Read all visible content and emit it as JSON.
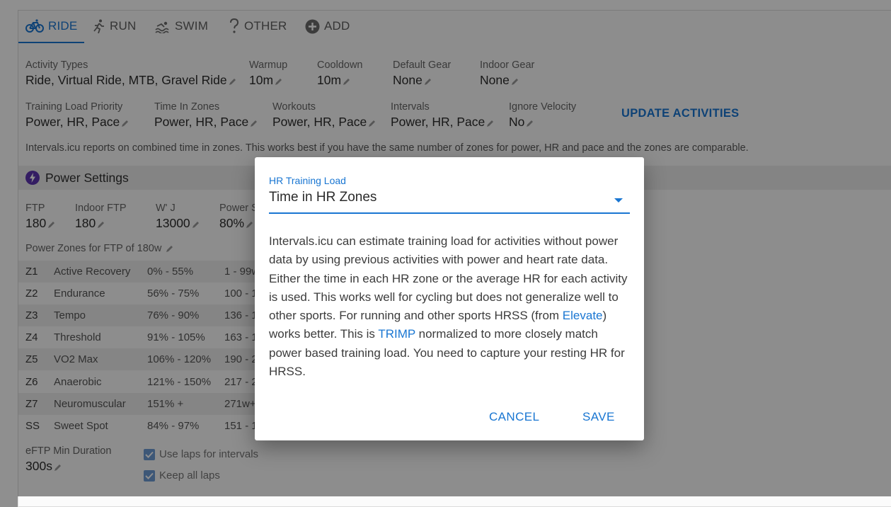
{
  "tabs": [
    {
      "label": "RIDE",
      "icon": "bicycle-icon",
      "active": true
    },
    {
      "label": "RUN",
      "icon": "runner-icon"
    },
    {
      "label": "SWIM",
      "icon": "swimmer-icon"
    },
    {
      "label": "OTHER",
      "icon": "question-icon"
    },
    {
      "label": "ADD",
      "icon": "plus-circle-icon"
    }
  ],
  "row1": [
    {
      "label": "Activity Types",
      "value": "Ride, Virtual Ride, MTB, Gravel Ride"
    },
    {
      "label": "Warmup",
      "value": "10m"
    },
    {
      "label": "Cooldown",
      "value": "10m"
    },
    {
      "label": "Default Gear",
      "value": "None"
    },
    {
      "label": "Indoor Gear",
      "value": "None"
    }
  ],
  "row2": [
    {
      "label": "Training Load Priority",
      "value": "Power, HR, Pace"
    },
    {
      "label": "Time In Zones",
      "value": "Power, HR, Pace"
    },
    {
      "label": "Workouts",
      "value": "Power, HR, Pace"
    },
    {
      "label": "Intervals",
      "value": "Power, HR, Pace"
    },
    {
      "label": "Ignore Velocity",
      "value": "No"
    }
  ],
  "update_button": "UPDATE ACTIVITIES",
  "note": "Intervals.icu reports on combined time in zones. This works best if you have the same number of zones for power, HR and pace and the zones are comparable.",
  "power_settings": {
    "title": "Power Settings",
    "fields": [
      {
        "label": "FTP",
        "value": "180"
      },
      {
        "label": "Indoor FTP",
        "value": "180"
      },
      {
        "label": "W' J",
        "value": "13000"
      },
      {
        "label": "Power S",
        "value": "80%"
      }
    ],
    "zones_label": "Power Zones for FTP of 180w",
    "zones": [
      {
        "z": "Z1",
        "name": "Active Recovery",
        "pct": "0% - 55%",
        "watts": "1 - 99w"
      },
      {
        "z": "Z2",
        "name": "Endurance",
        "pct": "56% - 75%",
        "watts": "100 - 1"
      },
      {
        "z": "Z3",
        "name": "Tempo",
        "pct": "76% - 90%",
        "watts": "136 - 1"
      },
      {
        "z": "Z4",
        "name": "Threshold",
        "pct": "91% - 105%",
        "watts": "163 - 1"
      },
      {
        "z": "Z5",
        "name": "VO2 Max",
        "pct": "106% - 120%",
        "watts": "190 - 2"
      },
      {
        "z": "Z6",
        "name": "Anaerobic",
        "pct": "121% - 150%",
        "watts": "217 - 2"
      },
      {
        "z": "Z7",
        "name": "Neuromuscular",
        "pct": "151% +",
        "watts": "271w+"
      },
      {
        "z": "SS",
        "name": "Sweet Spot",
        "pct": "84% - 97%",
        "watts": "151 - 1"
      }
    ],
    "eftp": {
      "label": "eFTP Min Duration",
      "value": "300s"
    },
    "checks": [
      "Use laps for intervals",
      "Keep all laps"
    ]
  },
  "dialog": {
    "select_label": "HR Training Load",
    "select_value": "Time in HR Zones",
    "text_1": "Intervals.icu can estimate training load for activities without power data by using previous activities with power and heart rate data. Either the time in each HR zone or the average HR for each activity is used. This works well for cycling but does not generalize well to other sports. For running and other sports HRSS (from ",
    "link_1": "Elevate",
    "text_2": ") works better. This is ",
    "link_2": "TRIMP",
    "text_3": " normalized to more closely match power based training load. You need to capture your resting HR for HRSS.",
    "cancel": "CANCEL",
    "save": "SAVE"
  },
  "colors": {
    "accent": "#1976d2",
    "power_icon": "#5e35b1"
  }
}
